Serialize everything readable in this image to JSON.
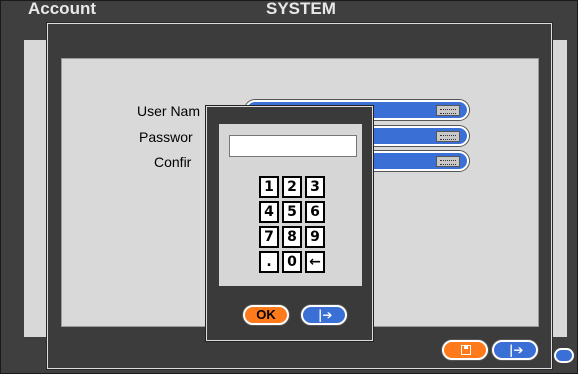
{
  "background": {
    "title_left": "Account",
    "title_center": "SYSTEM"
  },
  "account_form": {
    "fields": [
      {
        "label": "User Nam"
      },
      {
        "label": "Passwor"
      },
      {
        "label": "Confir"
      }
    ],
    "keyboard_icon": "keyboard-icon"
  },
  "keypad": {
    "display_value": "",
    "keys": [
      "1",
      "2",
      "3",
      "4",
      "5",
      "6",
      "7",
      "8",
      "9",
      ".",
      "0",
      "←"
    ],
    "ok_label": "OK",
    "exit_icon": "exit-icon"
  },
  "footer": {
    "save_icon": "save-icon",
    "exit_icon": "exit-icon"
  },
  "colors": {
    "accent_blue": "#3a6fd6",
    "accent_orange": "#ff7a1a",
    "window_dark": "#3c3c3c",
    "panel_gray": "#d9d9d9"
  }
}
